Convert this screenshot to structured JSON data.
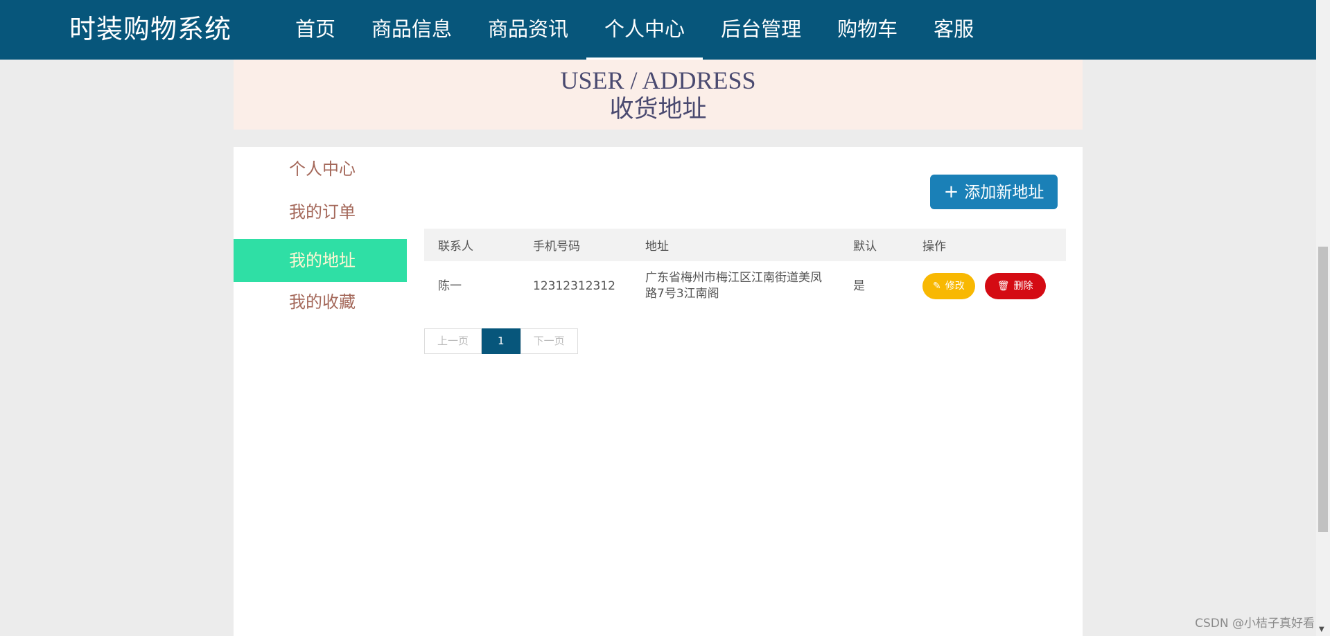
{
  "navbar": {
    "brand": "时装购物系统",
    "items": [
      {
        "label": "首页"
      },
      {
        "label": "商品信息"
      },
      {
        "label": "商品资讯"
      },
      {
        "label": "个人中心",
        "active": true
      },
      {
        "label": "后台管理"
      },
      {
        "label": "购物车"
      },
      {
        "label": "客服"
      }
    ]
  },
  "banner": {
    "title_en": "USER / ADDRESS",
    "title_cn": "收货地址"
  },
  "side_menu": [
    {
      "label": "个人中心"
    },
    {
      "label": "我的订单"
    },
    {
      "label": "我的地址",
      "active": true
    },
    {
      "label": "我的收藏"
    }
  ],
  "add_button": {
    "label": "添加新地址",
    "icon": "plus-icon"
  },
  "table": {
    "headers": [
      "联系人",
      "手机号码",
      "地址",
      "默认",
      "操作"
    ],
    "rows": [
      {
        "contact": "陈一",
        "phone": "12312312312",
        "address": "广东省梅州市梅江区江南街道美凤路7号3江南阁",
        "default": "是"
      }
    ],
    "edit_label": "修改",
    "delete_label": "删除"
  },
  "pagination": {
    "prev": "上一页",
    "current": "1",
    "next": "下一页"
  },
  "watermark": "CSDN @小桔子真好看",
  "colors": {
    "navbar": "#07567b",
    "active_side": "#2fdfa5",
    "edit": "#f8b802",
    "delete": "#d40b13",
    "add": "#1a80b7"
  }
}
